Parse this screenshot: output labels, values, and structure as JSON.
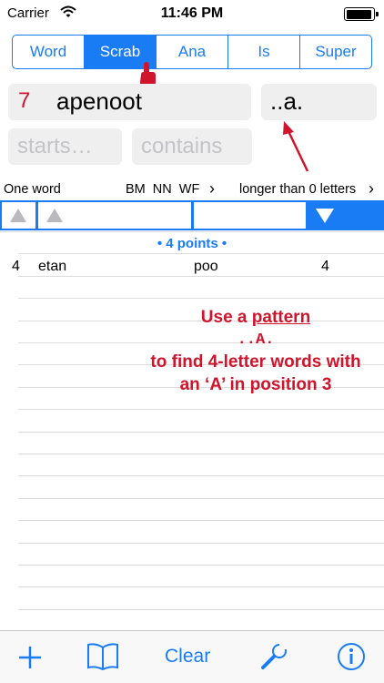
{
  "status": {
    "carrier": "Carrier",
    "time": "11:46 PM"
  },
  "tabs": [
    {
      "label": "Word",
      "active": false
    },
    {
      "label": "Scrab",
      "active": true
    },
    {
      "label": "Ana",
      "active": false
    },
    {
      "label": "Is",
      "active": false
    },
    {
      "label": "Super",
      "active": false
    }
  ],
  "letters": {
    "count": "7",
    "value": "apenoot"
  },
  "pattern": {
    "value": "..a."
  },
  "starts": {
    "placeholder": "starts…"
  },
  "contains": {
    "placeholder": "contains"
  },
  "info": {
    "mode": "One word",
    "flags": "BM  NN  WF",
    "length_filter": "longer than 0 letters"
  },
  "results": {
    "group_header": "• 4 points •",
    "rows": [
      {
        "col1": "4",
        "word": "etan",
        "col3": "poo",
        "col4": "4"
      }
    ]
  },
  "annotation": {
    "line1": "Use a ",
    "line1_link": "pattern",
    "line2": "..A.",
    "line3": "to find 4-letter words with",
    "line4": "an ‘A’ in position 3"
  },
  "toolbar": {
    "clear_label": "Clear"
  },
  "colors": {
    "accent": "#1a7cf5",
    "annotation": "#d0142c"
  }
}
